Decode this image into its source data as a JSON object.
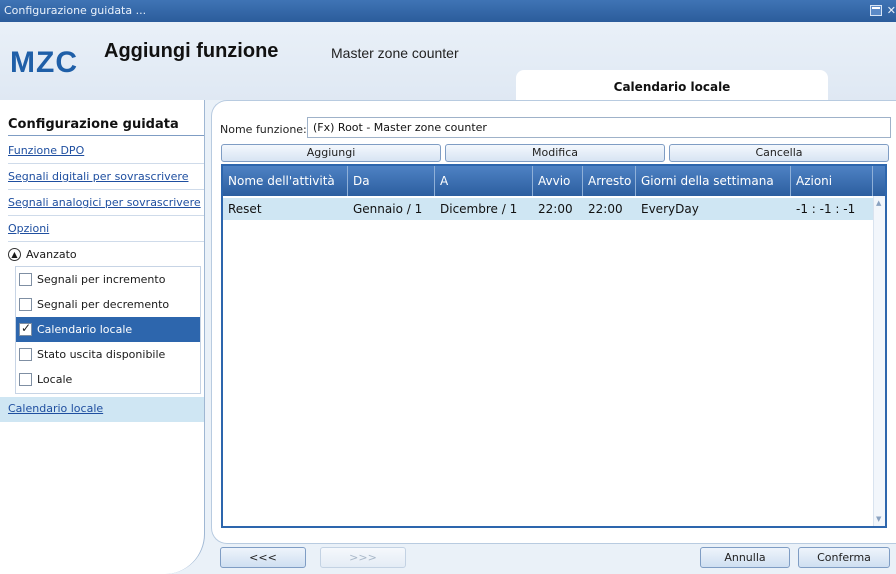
{
  "window": {
    "title": "Configurazione guidata ..."
  },
  "header": {
    "logo": "MZC",
    "title": "Aggiungi funzione",
    "subtitle": "Master zone counter",
    "tab": "Calendario locale"
  },
  "sidebar": {
    "title": "Configurazione guidata",
    "links": [
      "Funzione DPO",
      "Segnali digitali per sovrascrivere",
      "Segnali analogici per sovrascrivere",
      "Opzioni"
    ],
    "advanced_label": "Avanzato",
    "options": [
      {
        "label": "Segnali per incremento",
        "checked": false
      },
      {
        "label": "Segnali per decremento",
        "checked": false
      },
      {
        "label": "Calendario locale",
        "checked": true
      },
      {
        "label": "Stato uscita disponibile",
        "checked": false
      },
      {
        "label": "Locale",
        "checked": false
      }
    ],
    "active_link": "Calendario locale"
  },
  "main": {
    "name_label": "Nome funzione:",
    "name_value": "(Fx) Root - Master zone counter",
    "buttons": {
      "add": "Aggiungi",
      "edit": "Modifica",
      "delete": "Cancella"
    },
    "columns": [
      "Nome dell'attività",
      "Da",
      "A",
      "Avvio",
      "Arresto",
      "Giorni della settimana",
      "Azioni"
    ],
    "rows": [
      [
        "Reset",
        "Gennaio / 1",
        "Dicembre / 1",
        "22:00",
        "22:00",
        "EveryDay",
        "-1 : -1 : -1"
      ]
    ]
  },
  "footer": {
    "prev": "<<<",
    "next": ">>>",
    "cancel": "Annulla",
    "confirm": "Conferma"
  },
  "colors": {
    "accent": "#2d66ad",
    "selected_row": "#cfe6f3",
    "title_bar": "#2b5c9b"
  }
}
